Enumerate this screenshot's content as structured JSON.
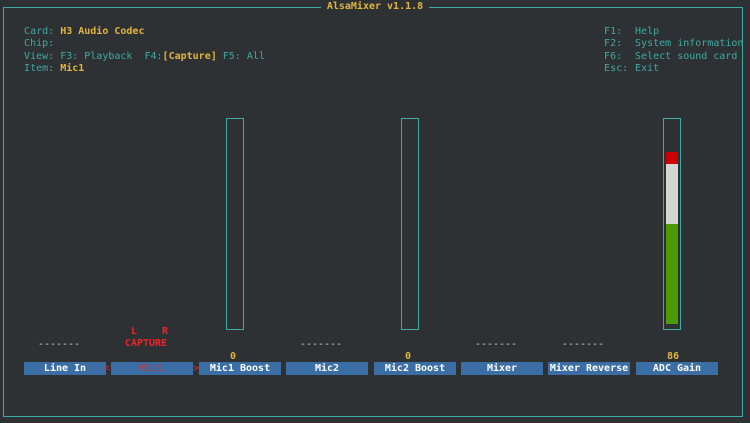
{
  "title": "AlsaMixer v1.1.8",
  "info": {
    "card_key": "Card:",
    "card_value": "H3 Audio Codec",
    "chip_key": "Chip:",
    "chip_value": "",
    "view_key": "View:",
    "view_f3": "F3: Playback",
    "view_f4_key": "F4:",
    "view_f4_value": "[Capture]",
    "view_f5": "F5: All",
    "item_key": "Item:",
    "item_value": "Mic1"
  },
  "help": [
    {
      "key": "F1:",
      "label": "Help"
    },
    {
      "key": "F2:",
      "label": "System information"
    },
    {
      "key": "F6:",
      "label": "Select sound card"
    },
    {
      "key": "Esc:",
      "label": "Exit"
    }
  ],
  "controls": [
    {
      "label": "Line In",
      "status": "-------"
    },
    {
      "label": "Mic1",
      "capture": "CAPTURE",
      "left": "L",
      "right": "R",
      "selected": true,
      "sel_left": "<",
      "sel_right": ">"
    },
    {
      "label": "Mic1 Boost",
      "value": "0",
      "level": 0
    },
    {
      "label": "Mic2",
      "status": "-------"
    },
    {
      "label": "Mic2 Boost",
      "value": "0",
      "level": 0
    },
    {
      "label": "Mixer",
      "status": "-------"
    },
    {
      "label": "Mixer Reverse",
      "status": "-------"
    },
    {
      "label": "ADC Gain",
      "value": "86",
      "level": 86
    }
  ],
  "colors": {
    "background": "#2d3134",
    "frame": "#3fa9a3",
    "highlight": "#e2b53a",
    "label_bg": "#3a6ea5",
    "selected": "#e8262a",
    "meter_green": "#4e9a06",
    "meter_white": "#d3d7cf",
    "meter_red": "#cc0000"
  }
}
